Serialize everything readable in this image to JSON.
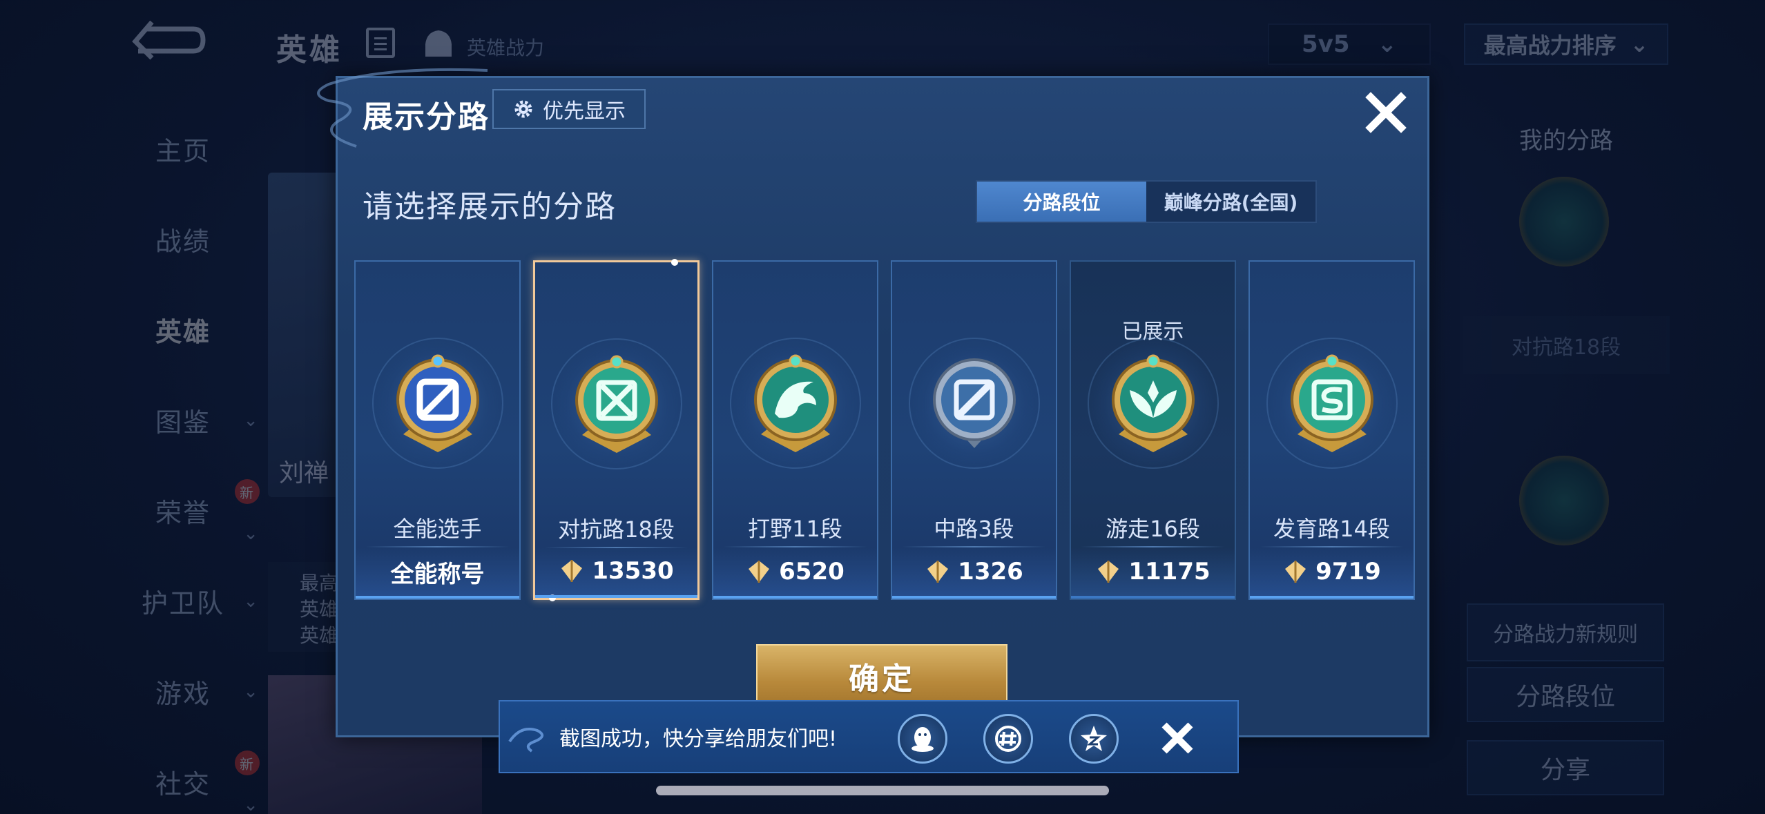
{
  "background": {
    "page_title": "英雄",
    "power_label": "英雄战力",
    "mode_select": "5v5",
    "sort_select": "最高战力排序",
    "nav": [
      {
        "label": "主页"
      },
      {
        "label": "战绩"
      },
      {
        "label": "英雄"
      },
      {
        "label": "图鉴"
      },
      {
        "label": "荣誉"
      },
      {
        "label": "护卫队"
      },
      {
        "label": "游戏"
      },
      {
        "label": "社交"
      }
    ],
    "new_badge": "新",
    "hero_name": "刘禅",
    "hero_info_lines": [
      "最高",
      "英雄",
      "英雄"
    ],
    "right_panel": {
      "title": "我的分路",
      "rank": "对抗路18段",
      "rules_button": "分路战力新规则",
      "tier_button": "分路段位",
      "share_button": "分享"
    }
  },
  "modal": {
    "title": "展示分路",
    "priority_button": "优先显示",
    "prompt": "请选择展示的分路",
    "tabs": [
      {
        "label": "分路段位",
        "active": true
      },
      {
        "label": "巅峰分路(全国)",
        "active": false
      }
    ],
    "lanes": [
      {
        "name": "全能选手",
        "footer": "全能称号",
        "has_icon": false,
        "selected": false,
        "displayed": false,
        "emblem": "all-round-emblem"
      },
      {
        "name": "对抗路18段",
        "footer": "13530",
        "has_icon": true,
        "selected": true,
        "displayed": false,
        "emblem": "clash-lane-emblem"
      },
      {
        "name": "打野11段",
        "footer": "6520",
        "has_icon": true,
        "selected": false,
        "displayed": false,
        "emblem": "jungle-emblem"
      },
      {
        "name": "中路3段",
        "footer": "1326",
        "has_icon": true,
        "selected": false,
        "displayed": false,
        "emblem": "mid-lane-emblem"
      },
      {
        "name": "游走16段",
        "footer": "11175",
        "has_icon": true,
        "selected": false,
        "displayed": true,
        "emblem": "roam-emblem"
      },
      {
        "name": "发育路14段",
        "footer": "9719",
        "has_icon": true,
        "selected": false,
        "displayed": false,
        "emblem": "farm-lane-emblem"
      }
    ],
    "displayed_label": "已展示",
    "confirm_button": "确定"
  },
  "toast": {
    "message": "截图成功，快分享给朋友们吧!",
    "share_targets": [
      "qq-icon",
      "wechat-moments-icon",
      "qzone-icon"
    ]
  },
  "colors": {
    "accent_gold": "#d9b468",
    "selected_border": "#f1c99a",
    "tab_active": "#4f87cf",
    "badge_red": "#d3362f"
  }
}
